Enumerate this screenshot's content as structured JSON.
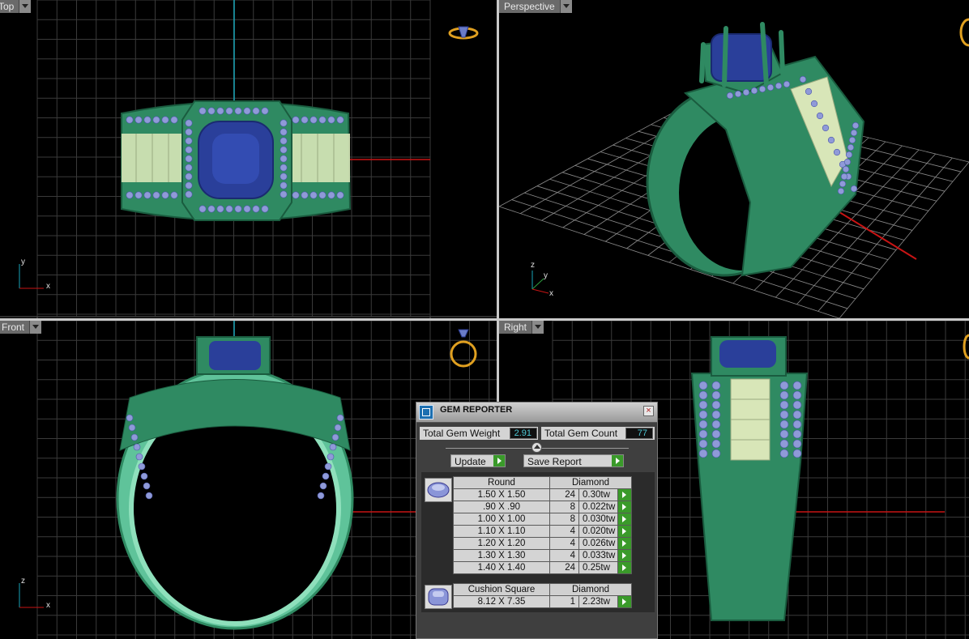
{
  "viewports": {
    "top": {
      "label": "Top"
    },
    "perspective": {
      "label": "Perspective"
    },
    "front": {
      "label": "Front"
    },
    "right": {
      "label": "Right"
    }
  },
  "axes": {
    "top": {
      "v": "y",
      "h": "x"
    },
    "perspective": {
      "z": "z",
      "y": "y",
      "x": "x"
    },
    "front": {
      "v": "z",
      "h": "x"
    }
  },
  "colors": {
    "metal": "#2f8a62",
    "metal_light": "#6fd0a6",
    "metal_dark": "#1a5c3f",
    "sapphire": "#2a3f9a",
    "melee": "#8f9ad8",
    "baguette": "#d8e6b8",
    "axis_red": "#c81414",
    "axis_cyan": "#19a5b8",
    "grid": "#5a5a5a",
    "nav_gold": "#e0a020"
  },
  "gem_reporter": {
    "title": "GEM REPORTER",
    "close": "×",
    "total_weight_label": "Total Gem Weight",
    "total_weight": "2.91",
    "total_count_label": "Total Gem Count",
    "total_count": "77",
    "update_label": "Update",
    "save_label": "Save Report",
    "groups": [
      {
        "shape": "Round",
        "material": "Diamond",
        "rows": [
          {
            "size": "1.50 X 1.50",
            "count": "24",
            "weight": "0.30tw"
          },
          {
            "size": ".90 X .90",
            "count": "8",
            "weight": "0.022tw"
          },
          {
            "size": "1.00 X 1.00",
            "count": "8",
            "weight": "0.030tw"
          },
          {
            "size": "1.10 X 1.10",
            "count": "4",
            "weight": "0.020tw"
          },
          {
            "size": "1.20 X 1.20",
            "count": "4",
            "weight": "0.026tw"
          },
          {
            "size": "1.30 X 1.30",
            "count": "4",
            "weight": "0.033tw"
          },
          {
            "size": "1.40 X 1.40",
            "count": "24",
            "weight": "0.25tw"
          }
        ]
      },
      {
        "shape": "Cushion Square",
        "material": "Diamond",
        "rows": [
          {
            "size": "8.12 X 7.35",
            "count": "1",
            "weight": "2.23tw"
          }
        ]
      }
    ]
  }
}
